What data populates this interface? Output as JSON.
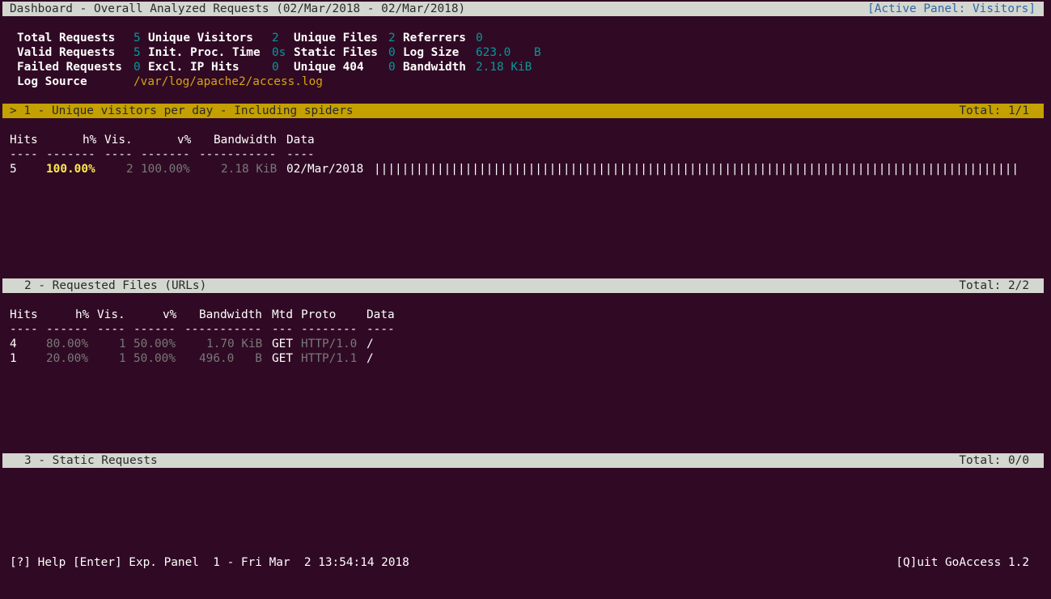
{
  "header": {
    "title": "Dashboard - Overall Analyzed Requests (02/Mar/2018 - 02/Mar/2018)",
    "active_panel": "[Active Panel: Visitors]"
  },
  "overall": {
    "total_requests": {
      "label": "Total Requests",
      "value": "5"
    },
    "valid_requests": {
      "label": "Valid Requests",
      "value": "5"
    },
    "failed_requests": {
      "label": "Failed Requests",
      "value": "0"
    },
    "log_source": {
      "label": "Log Source",
      "value": "/var/log/apache2/access.log"
    },
    "unique_visitors": {
      "label": "Unique Visitors",
      "value": "2"
    },
    "init_proc_time": {
      "label": "Init. Proc. Time",
      "value": "0s"
    },
    "excl_ip_hits": {
      "label": "Excl. IP Hits",
      "value": "0"
    },
    "unique_files": {
      "label": "Unique Files",
      "value": "2"
    },
    "static_files": {
      "label": "Static Files",
      "value": "0"
    },
    "unique_404": {
      "label": "Unique 404",
      "value": "0"
    },
    "referrers": {
      "label": "Referrers",
      "value": "0"
    },
    "log_size": {
      "label": "Log Size",
      "value": "623.0",
      "unit": "B"
    },
    "bandwidth": {
      "label": "Bandwidth",
      "value": "2.18 KiB"
    }
  },
  "panels": [
    {
      "title": "> 1 - Unique visitors per day - Including spiders",
      "total": "Total: 1/1",
      "headers": {
        "hits": "Hits",
        "hp": "h%",
        "vis": "Vis.",
        "vp": "v%",
        "bw": "Bandwidth",
        "data": "Data"
      },
      "dashes": {
        "hits": "----",
        "hp": "-------",
        "vis": "----",
        "vp": "-------",
        "bw": "-----------",
        "data": "----"
      },
      "rows": [
        {
          "hits": "5",
          "hp": "100.00%",
          "vis": "2",
          "vp": "100.00%",
          "bw": "2.18 KiB",
          "data": "02/Mar/2018",
          "bar": 1.0
        }
      ]
    },
    {
      "title": "2 - Requested Files (URLs)",
      "total": "Total: 2/2",
      "headers": {
        "hits": "Hits",
        "hp": "h%",
        "vis": "Vis.",
        "vp": "v%",
        "bw": "Bandwidth",
        "mtd": "Mtd",
        "proto": "Proto",
        "data": "Data"
      },
      "dashes": {
        "hits": "----",
        "hp": "------",
        "vis": "----",
        "vp": "------",
        "bw": "-----------",
        "mtd": "---",
        "proto": "--------",
        "data": "----"
      },
      "rows": [
        {
          "hits": "4",
          "hp": "80.00%",
          "vis": "1",
          "vp": "50.00%",
          "bw": "1.70 KiB",
          "mtd": "GET",
          "proto": "HTTP/1.0",
          "data": "/"
        },
        {
          "hits": "1",
          "hp": "20.00%",
          "vis": "1",
          "vp": "50.00%",
          "bw": "496.0   B",
          "mtd": "GET",
          "proto": "HTTP/1.1",
          "data": "/"
        }
      ]
    },
    {
      "title": "3 - Static Requests",
      "total": "Total: 0/0"
    }
  ],
  "footer": {
    "help": "[?] Help [Enter] Exp. Panel  1 - Fri Mar  2 13:54:14 2018",
    "quit": "[Q]uit GoAccess 1.2"
  },
  "colors": {
    "background": "#300a24",
    "panel_bar": "#d3d7cf",
    "active_panel_bar": "#c4a000",
    "value_teal": "#06989a",
    "highlight_yellow": "#fce94f",
    "log_source_gold": "#d6a312",
    "dim_gray": "#787878",
    "active_panel_blue": "#3465a4"
  }
}
